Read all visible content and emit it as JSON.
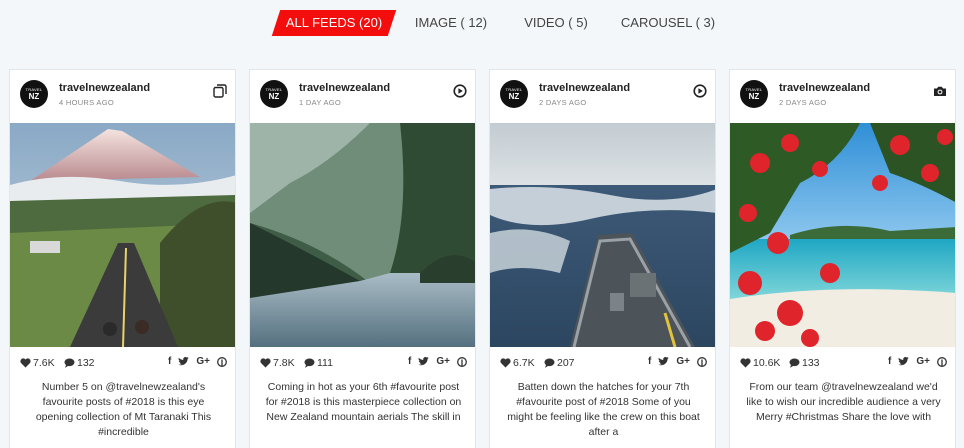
{
  "tabs": [
    {
      "label": "ALL FEEDS (20)",
      "active": true
    },
    {
      "label": "IMAGE ( 12)",
      "active": false
    },
    {
      "label": "VIDEO ( 5)",
      "active": false
    },
    {
      "label": "CAROUSEL ( 3)",
      "active": false
    }
  ],
  "colors": {
    "accent": "#f40d0d",
    "background": "#f4f7f9"
  },
  "avatar": {
    "line1": "TRAVEL",
    "line2": "NZ"
  },
  "share_icons": [
    "facebook-icon",
    "twitter-icon",
    "google-plus-icon",
    "pinterest-icon"
  ],
  "share_glyphs": {
    "facebook": "f",
    "google": "G+"
  },
  "posts": [
    {
      "username": "travelnewzealand",
      "time": "4 HOURS AGO",
      "type_icon": "carousel-icon",
      "photo_icon": "mountain-road-photo",
      "likes": "7.6K",
      "comments": "132",
      "caption": "Number 5 on @travelnewzealand's favourite posts of #2018 is this eye opening collection of Mt Taranaki This #incredible"
    },
    {
      "username": "travelnewzealand",
      "time": "1 DAY AGO",
      "type_icon": "video-play-icon",
      "photo_icon": "fiord-aerial-photo",
      "likes": "7.8K",
      "comments": "111",
      "caption": "Coming in hot as your 6th #favourite post for #2018 is this masterpiece collection on New Zealand mountain aerials The skill in"
    },
    {
      "username": "travelnewzealand",
      "time": "2 DAYS AGO",
      "type_icon": "video-play-icon",
      "photo_icon": "ship-waves-photo",
      "likes": "6.7K",
      "comments": "207",
      "caption": "Batten down the hatches for your 7th #favourite post of #2018 Some of you might be feeling like the crew on this boat after a"
    },
    {
      "username": "travelnewzealand",
      "time": "2 DAYS AGO",
      "type_icon": "camera-icon",
      "photo_icon": "pohutukawa-beach-photo",
      "likes": "10.6K",
      "comments": "133",
      "caption": "From our team @travelnewzealand we'd like to wish our incredible audience a very Merry #Christmas Share the love with"
    }
  ]
}
